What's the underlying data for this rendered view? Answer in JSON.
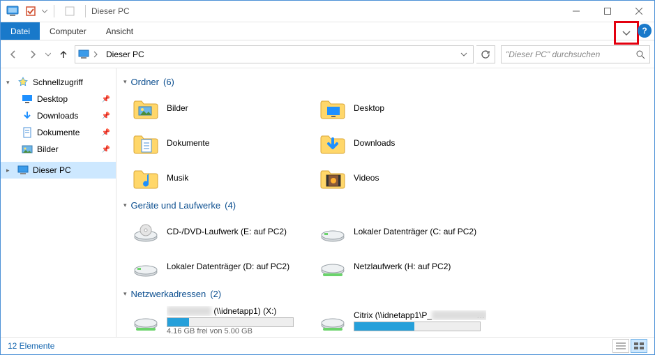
{
  "window": {
    "title": "Dieser PC"
  },
  "ribbon": {
    "file": "Datei",
    "tabs": [
      "Computer",
      "Ansicht"
    ]
  },
  "address": {
    "crumb": "Dieser PC"
  },
  "search": {
    "placeholder": "\"Dieser PC\" durchsuchen"
  },
  "sidebar": {
    "quickaccess": "Schnellzugriff",
    "qa_items": [
      {
        "label": "Desktop",
        "icon": "desktop"
      },
      {
        "label": "Downloads",
        "icon": "downloads"
      },
      {
        "label": "Dokumente",
        "icon": "documents"
      },
      {
        "label": "Bilder",
        "icon": "pictures"
      }
    ],
    "thispc": "Dieser PC"
  },
  "groups": {
    "folders": {
      "label": "Ordner",
      "count": "(6)"
    },
    "devices": {
      "label": "Geräte und Laufwerke",
      "count": "(4)"
    },
    "network": {
      "label": "Netzwerkadressen",
      "count": "(2)"
    }
  },
  "folders": [
    {
      "label": "Bilder",
      "icon": "pictures"
    },
    {
      "label": "Desktop",
      "icon": "desktop"
    },
    {
      "label": "Dokumente",
      "icon": "documents"
    },
    {
      "label": "Downloads",
      "icon": "downloads"
    },
    {
      "label": "Musik",
      "icon": "music"
    },
    {
      "label": "Videos",
      "icon": "videos"
    }
  ],
  "devices": [
    {
      "label": "CD-/DVD-Laufwerk (E: auf PC2)",
      "icon": "optical"
    },
    {
      "label": "Lokaler Datenträger (C: auf PC2)",
      "icon": "hdd"
    },
    {
      "label": "Lokaler Datenträger (D: auf PC2)",
      "icon": "hdd"
    },
    {
      "label": "Netzlaufwerk (H: auf PC2)",
      "icon": "netdrive"
    }
  ],
  "network_items": [
    {
      "label": "████████ (\\\\idnetapp1) (X:)",
      "sub": "4.16 GB frei von 5.00 GB",
      "fill": 17,
      "fill_color": "#26a0da",
      "blur": true
    },
    {
      "label": "Citrix (\\\\idnetapp1\\P_████████) ...",
      "sub": "",
      "fill": 48,
      "fill_color": "#26a0da",
      "blur_path": true
    }
  ],
  "status": {
    "count": "12 Elemente"
  }
}
